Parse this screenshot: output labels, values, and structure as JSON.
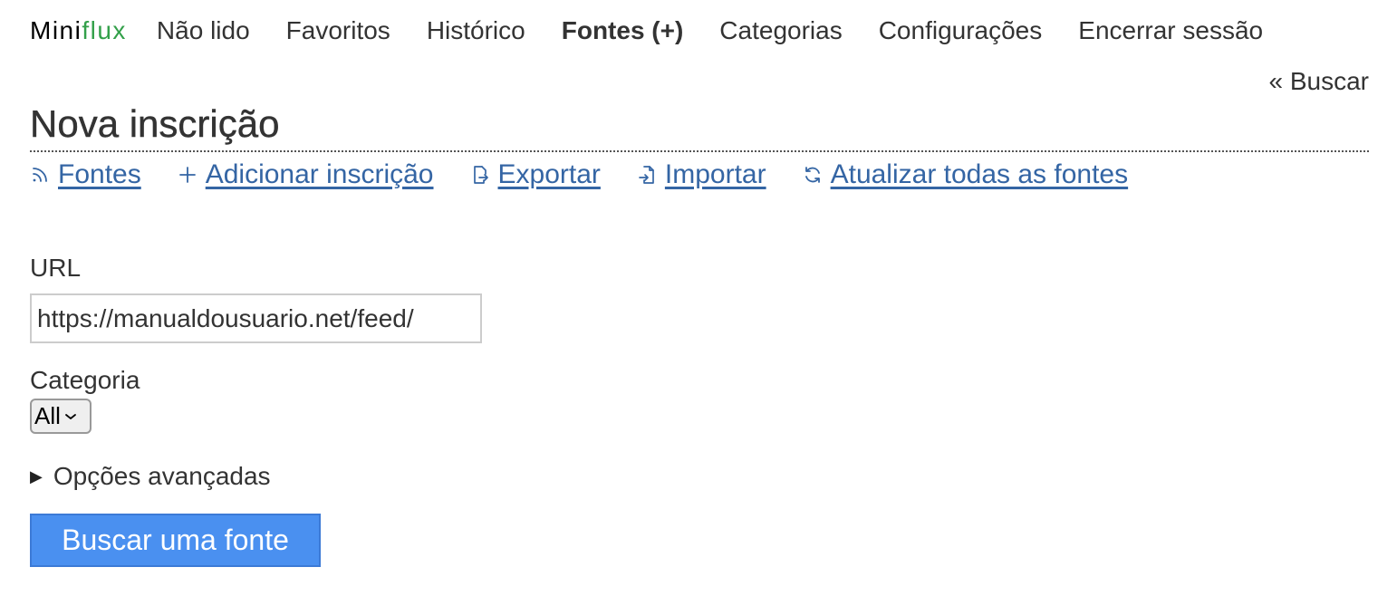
{
  "header": {
    "logo_prefix": "Mini",
    "logo_suffix": "flux",
    "nav": [
      {
        "label": "Não lido"
      },
      {
        "label": "Favoritos"
      },
      {
        "label": "Histórico"
      },
      {
        "label": "Fontes (+)",
        "active": true
      },
      {
        "label": "Categorias"
      },
      {
        "label": "Configurações"
      },
      {
        "label": "Encerrar sessão"
      }
    ]
  },
  "search_link": "« Buscar",
  "page_title": "Nova inscrição",
  "subnav": [
    {
      "label": "Fontes",
      "icon": "rss-icon"
    },
    {
      "label": "Adicionar inscrição",
      "icon": "plus-icon"
    },
    {
      "label": "Exportar",
      "icon": "export-icon"
    },
    {
      "label": "Importar",
      "icon": "import-icon"
    },
    {
      "label": "Atualizar todas as fontes",
      "icon": "refresh-icon"
    }
  ],
  "form": {
    "url_label": "URL",
    "url_value": "https://manualdousuario.net/feed/",
    "category_label": "Categoria",
    "category_value": "All",
    "advanced_label": "Opções avançadas",
    "submit_label": "Buscar uma fonte"
  },
  "colors": {
    "link": "#3465a4",
    "logo_accent": "#33a04a",
    "button": "#4a90f0"
  }
}
